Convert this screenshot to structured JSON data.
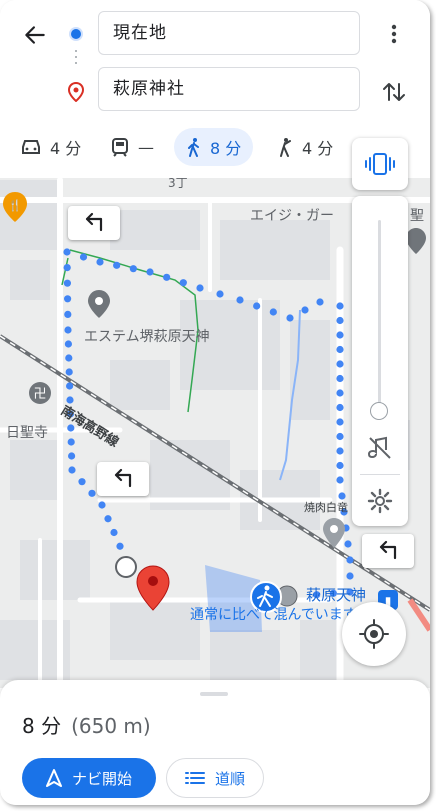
{
  "header": {
    "origin": "現在地",
    "destination": "萩原神社"
  },
  "modes": [
    {
      "icon": "car-icon",
      "label": "4 分"
    },
    {
      "icon": "train-icon",
      "label": "—"
    },
    {
      "icon": "walk-icon",
      "label": "8 分",
      "selected": true
    },
    {
      "icon": "ride-icon",
      "label": "4 分"
    }
  ],
  "map": {
    "labels": {
      "place_estem": "エステム堺萩原天神",
      "railway": "南海高野線",
      "temple": "日聖寺",
      "shop_top": "エイジ・ガー",
      "shop_top_suffix": "聖",
      "yakiniku": "焼肉白竜",
      "station": "萩原天神",
      "traffic_note": "通常に比べて混んでいます",
      "street_top": "3丁"
    }
  },
  "sheet": {
    "duration": "8 分",
    "distance": "(650 m)",
    "nav_button": "ナビ開始",
    "steps_button": "道順"
  },
  "colors": {
    "route_blue": "#4285f4",
    "accent": "#1a73e8",
    "pin_red": "#ea4335"
  }
}
